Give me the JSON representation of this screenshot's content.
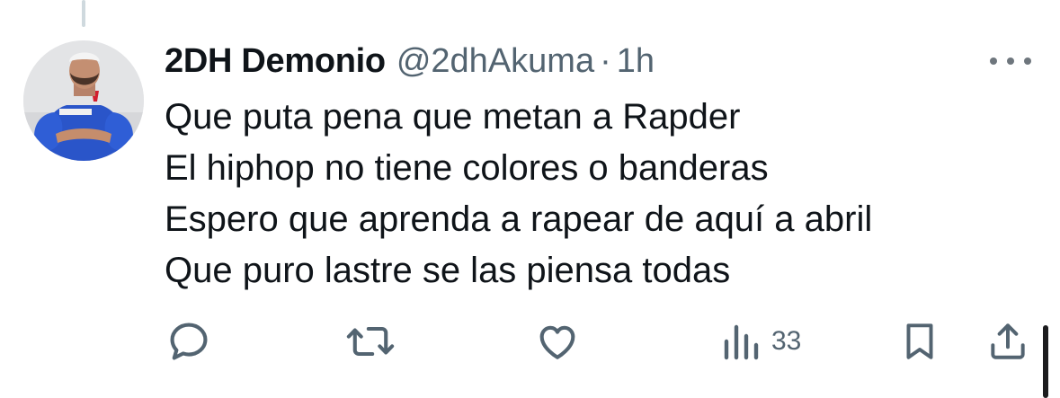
{
  "tweet": {
    "display_name": "2DH Demonio",
    "handle": "@2dhAkuma",
    "separator": "·",
    "time": "1h",
    "lines": [
      "Que puta pena que metan a Rapder",
      "El hiphop no tiene colores o banderas",
      "Espero que aprenda a rapear de aquí a abril",
      "Que puro lastre se las piensa todas"
    ]
  },
  "actions": {
    "reply": {
      "icon": "reply-icon",
      "count": ""
    },
    "repost": {
      "icon": "repost-icon",
      "count": ""
    },
    "like": {
      "icon": "heart-icon",
      "count": ""
    },
    "views": {
      "icon": "views-icon",
      "count": "33"
    },
    "bookmark": {
      "icon": "bookmark-icon"
    },
    "share": {
      "icon": "share-icon"
    }
  },
  "colors": {
    "text_primary": "#0f1419",
    "text_secondary": "#536471",
    "thread_line": "#cfd9de"
  }
}
